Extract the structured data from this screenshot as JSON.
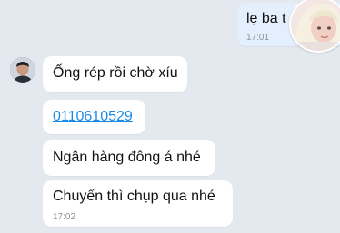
{
  "outgoing": {
    "text": "lẹ ba t",
    "time": "17:01"
  },
  "incoming": {
    "messages": [
      {
        "text": "Ống rép rồi chờ xíu"
      },
      {
        "text": "0110610529"
      },
      {
        "text": "Ngân hàng đông á nhé"
      },
      {
        "text": "Chuyển thì chụp qua nhé"
      }
    ],
    "time": "17:02"
  },
  "colors": {
    "background": "#e4e9f0",
    "outgoing_bubble": "#e3effd",
    "link": "#1a8bea"
  }
}
